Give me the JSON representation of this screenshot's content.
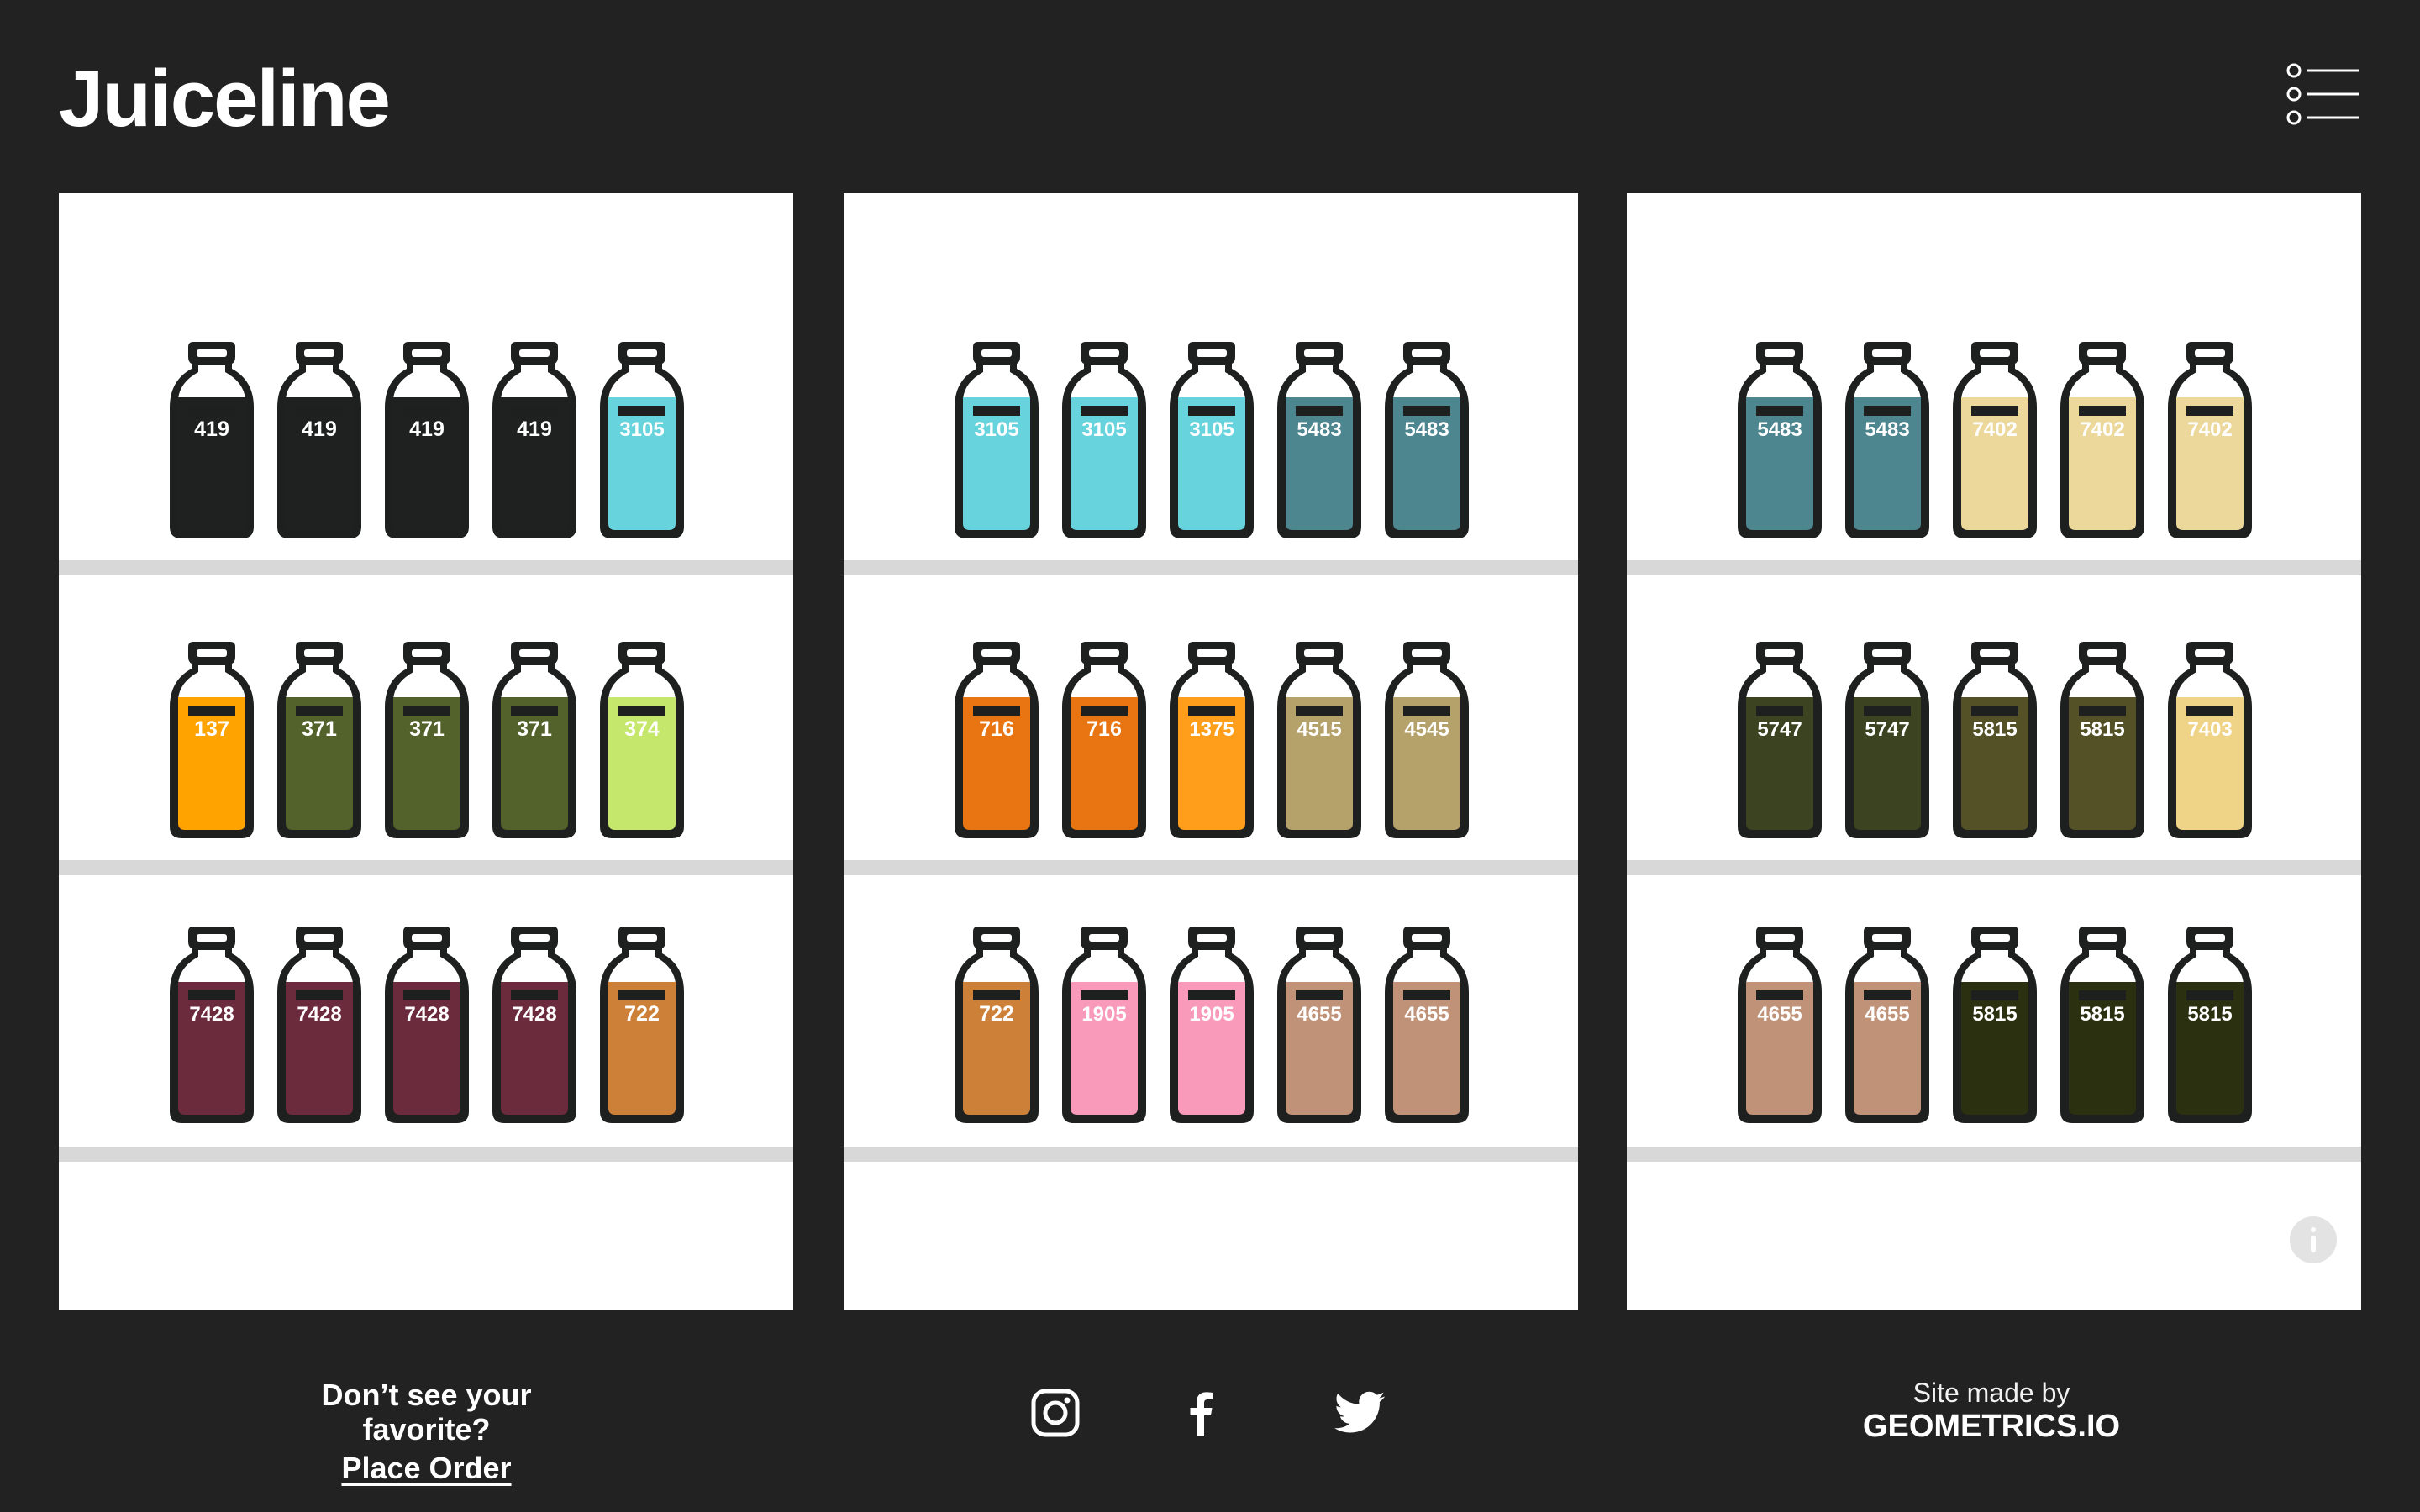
{
  "header": {
    "logo": "Juiceline",
    "menu_icon": "list-menu-icon"
  },
  "colors": {
    "background": "#212221",
    "panel": "#ffffff",
    "shelf": "#d8d8d8",
    "outline": "#1e1f1f"
  },
  "juice_colors": {
    "419": "#1f2020",
    "3105": "#67d3dd",
    "5483": "#4e8690",
    "7402": "#ecd89b",
    "137": "#ffa300",
    "371": "#53612a",
    "374": "#c5e86c",
    "716": "#e87511",
    "1375": "#ff9e1b",
    "4515": "#b5a16a",
    "4545": "#b5a16a",
    "5747": "#3b4320",
    "5815": "#555127",
    "7403": "#efd386",
    "7428": "#6c2a3d",
    "722": "#cd8038",
    "1905": "#fa9aba",
    "4655": "#c09379",
    "5815_dark": "#2b3010"
  },
  "shelves": [
    {
      "rows": [
        [
          "419",
          "419",
          "419",
          "419",
          "3105"
        ],
        [
          "137",
          "371",
          "371",
          "371",
          "374"
        ],
        [
          "7428",
          "7428",
          "7428",
          "7428",
          "722"
        ]
      ]
    },
    {
      "rows": [
        [
          "3105",
          "3105",
          "3105",
          "5483",
          "5483"
        ],
        [
          "716",
          "716",
          "1375",
          "4515",
          "4545"
        ],
        [
          "722",
          "1905",
          "1905",
          "4655",
          "4655"
        ]
      ]
    },
    {
      "rows": [
        [
          "5483",
          "5483",
          "7402",
          "7402",
          "7402"
        ],
        [
          "5747",
          "5747",
          "5815",
          "5815",
          "7403"
        ],
        [
          "4655",
          "4655",
          "5815",
          "5815",
          "5815"
        ]
      ]
    }
  ],
  "dark_overrides": [
    [
      2,
      2,
      2
    ],
    [
      2,
      2,
      3
    ],
    [
      2,
      2,
      4
    ]
  ],
  "info_icon": "info-icon",
  "footer": {
    "question": "Don’t see your favorite?",
    "order_link": "Place Order",
    "social": [
      "instagram-icon",
      "facebook-icon",
      "twitter-icon"
    ],
    "made_by": "Site made by",
    "studio": "GEOMETRICS.IO"
  }
}
